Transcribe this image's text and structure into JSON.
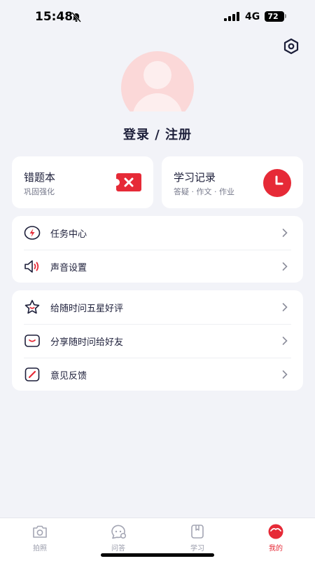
{
  "status_bar": {
    "time": "15:48",
    "network": "4G",
    "battery": "72"
  },
  "header": {
    "login_title": "登录 / 注册"
  },
  "cards": [
    {
      "title": "错题本",
      "subtitle": "巩固强化",
      "icon": "ticket-x-icon"
    },
    {
      "title": "学习记录",
      "subtitle": "答疑 · 作文 · 作业",
      "icon": "clock-icon"
    }
  ],
  "menu_group_1": [
    {
      "label": "任务中心",
      "icon": "lightning-icon"
    },
    {
      "label": "声音设置",
      "icon": "speaker-icon"
    }
  ],
  "menu_group_2": [
    {
      "label": "给随时问五星好评",
      "icon": "star-icon"
    },
    {
      "label": "分享随时问给好友",
      "icon": "share-smile-icon"
    },
    {
      "label": "意见反馈",
      "icon": "feedback-icon"
    }
  ],
  "tabs": [
    {
      "label": "拍照",
      "icon": "camera-icon",
      "active": false
    },
    {
      "label": "问答",
      "icon": "chat-icon",
      "active": false
    },
    {
      "label": "学习",
      "icon": "book-icon",
      "active": false
    },
    {
      "label": "我的",
      "icon": "profile-icon",
      "active": true
    }
  ],
  "colors": {
    "accent": "#e62a37",
    "text": "#1d1f3a",
    "background": "#f2f3f8",
    "avatar": "#fbd8d8"
  }
}
